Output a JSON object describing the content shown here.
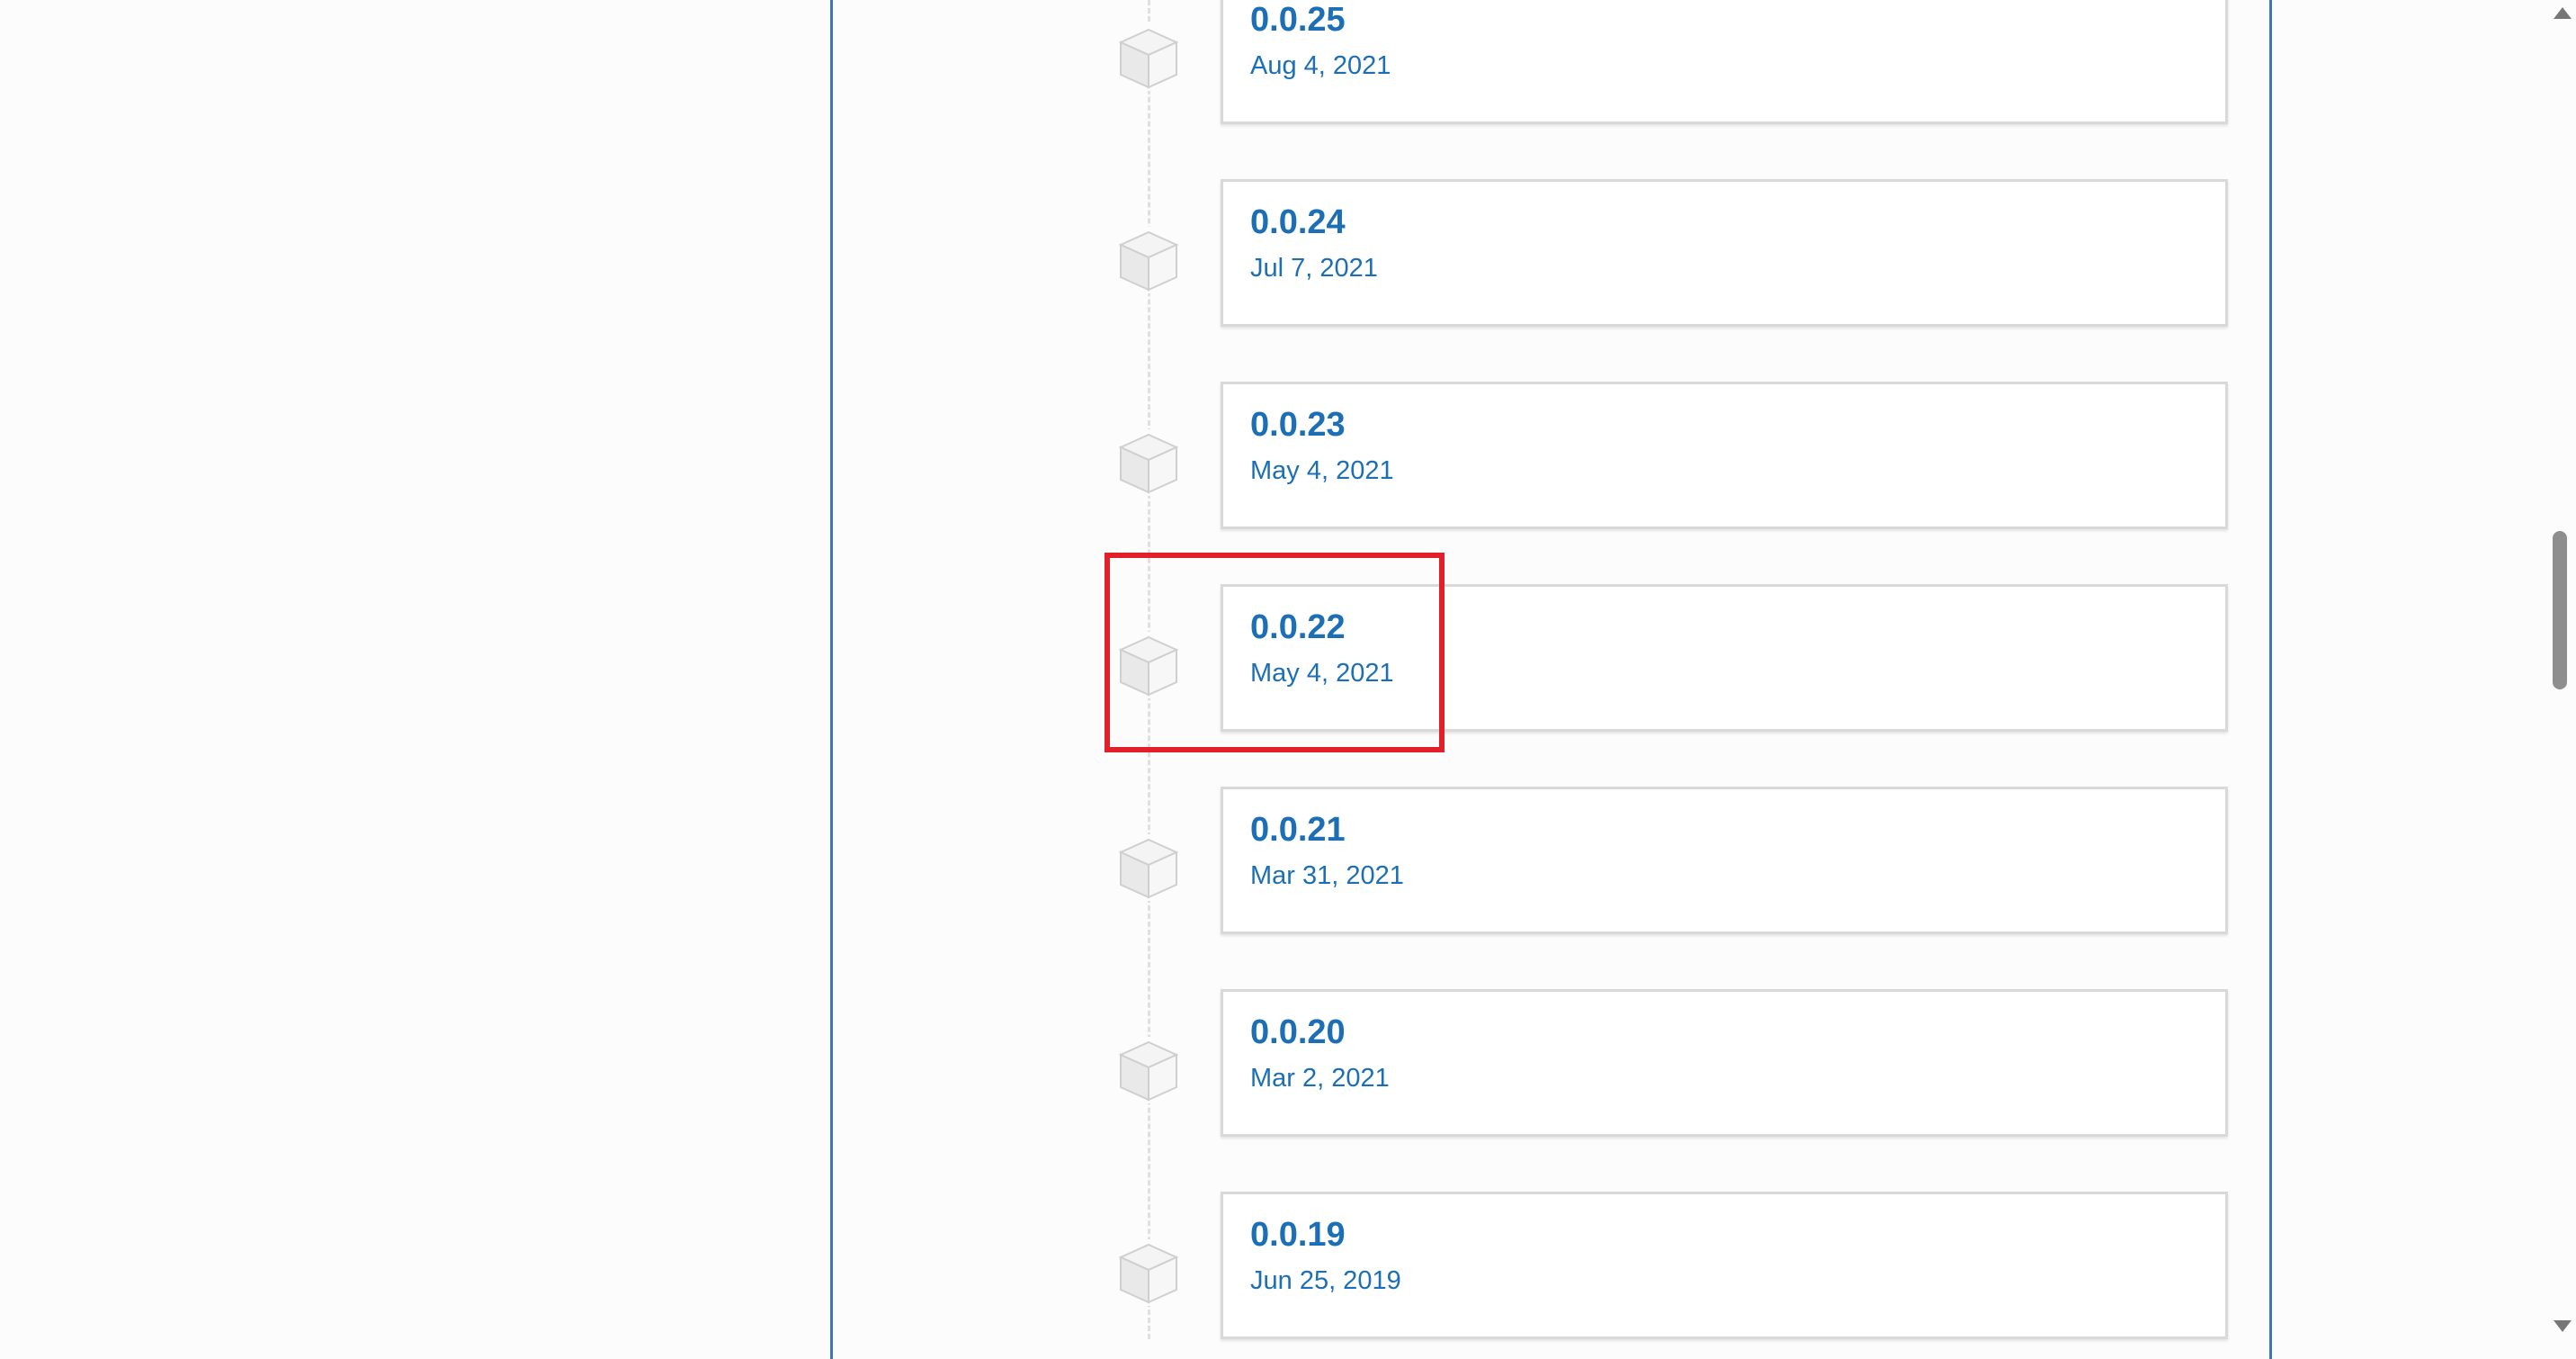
{
  "releases": [
    {
      "version": "0.0.25",
      "date": "Aug 4, 2021"
    },
    {
      "version": "0.0.24",
      "date": "Jul 7, 2021"
    },
    {
      "version": "0.0.23",
      "date": "May 4, 2021"
    },
    {
      "version": "0.0.22",
      "date": "May 4, 2021"
    },
    {
      "version": "0.0.21",
      "date": "Mar 31, 2021"
    },
    {
      "version": "0.0.20",
      "date": "Mar 2, 2021"
    },
    {
      "version": "0.0.19",
      "date": "Jun 25, 2019"
    }
  ],
  "highlighted_release": "0.0.22",
  "colors": {
    "link": "#1d6fb5",
    "panel_border": "#3d7ab3",
    "highlight": "#e0202b",
    "card_border": "#d9d9d9"
  },
  "icons": {
    "release_marker": "package-cube-icon",
    "scroll_up": "arrow-up-icon",
    "scroll_down": "arrow-down-icon"
  }
}
